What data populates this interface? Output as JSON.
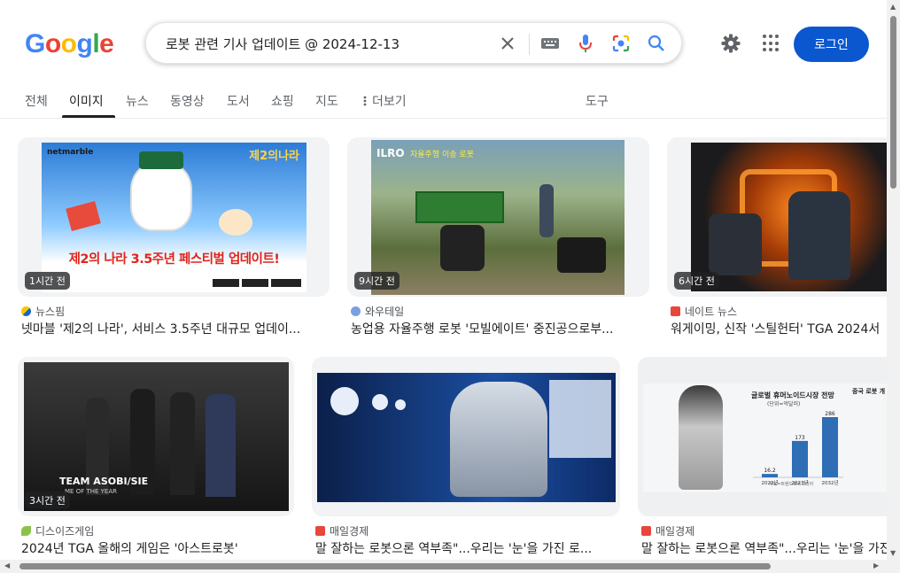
{
  "logo": {
    "letters": [
      "G",
      "o",
      "o",
      "g",
      "l",
      "e"
    ],
    "colors": [
      "#4285f4",
      "#ea4335",
      "#fbbc05",
      "#4285f4",
      "#34a853",
      "#ea4335"
    ]
  },
  "search": {
    "query": "로봇 관련 기사 업데이트 @ 2024-12-13"
  },
  "header": {
    "login_label": "로그인"
  },
  "tabs": [
    {
      "label": "전체"
    },
    {
      "label": "이미지",
      "active": true
    },
    {
      "label": "뉴스"
    },
    {
      "label": "동영상"
    },
    {
      "label": "도서"
    },
    {
      "label": "쇼핑"
    },
    {
      "label": "지도"
    },
    {
      "label": "더보기"
    },
    {
      "label": "도구"
    }
  ],
  "results": [
    {
      "time": "1시간 전",
      "source": "뉴스핌",
      "title": "넷마블 '제2의 나라', 서비스 3.5주년 대규모 업데이...",
      "thumb_text": "제2의 나라 3.5주년 페스티벌 업데이트!",
      "thumb_brand": "netmarble",
      "thumb_note": "제2의나라"
    },
    {
      "time": "9시간 전",
      "source": "와우테일",
      "title": "농업용 자율주행 로봇 '모빌에이트' 중진공으로부...",
      "thumb_text": "자율주행 이송 로봇",
      "thumb_brand": "ILRO"
    },
    {
      "time": "6시간 전",
      "source": "네이트 뉴스",
      "title": "워게이밍, 신작 '스틸헌터' TGA 2024서"
    },
    {
      "time": "3시간 전",
      "source": "디스이즈게임",
      "title": "2024년 TGA 올해의 게임은 '아스트로봇'",
      "thumb_text": "TEAM ASOBI/SIE",
      "thumb_sub": "ME OF THE YEAR"
    },
    {
      "source": "매일경제",
      "title": "말 잘하는 로봇으론 역부족\"...우리는 '눈'을 가진 로..."
    },
    {
      "source": "매일경제",
      "title": "말 잘하는 로봇으론 역부족\"...우리는 '눈'을 가진",
      "thumb_text": "글로벌 휴머노이드시장 전망",
      "thumb_unit": "(단위=억달러)",
      "thumb_side": "중국 로봇 개",
      "thumb_source": "자료=트렌드포스코리아"
    }
  ],
  "chart_data": {
    "type": "bar",
    "title": "글로벌 휴머노이드시장 전망",
    "ylabel": "(단위=억달러)",
    "categories": [
      "2022년",
      "2027년",
      "2032년"
    ],
    "values": [
      16.2,
      173,
      286
    ]
  },
  "colors": {
    "accent": "#0b57d0",
    "favicon_news": "#e8453c"
  }
}
